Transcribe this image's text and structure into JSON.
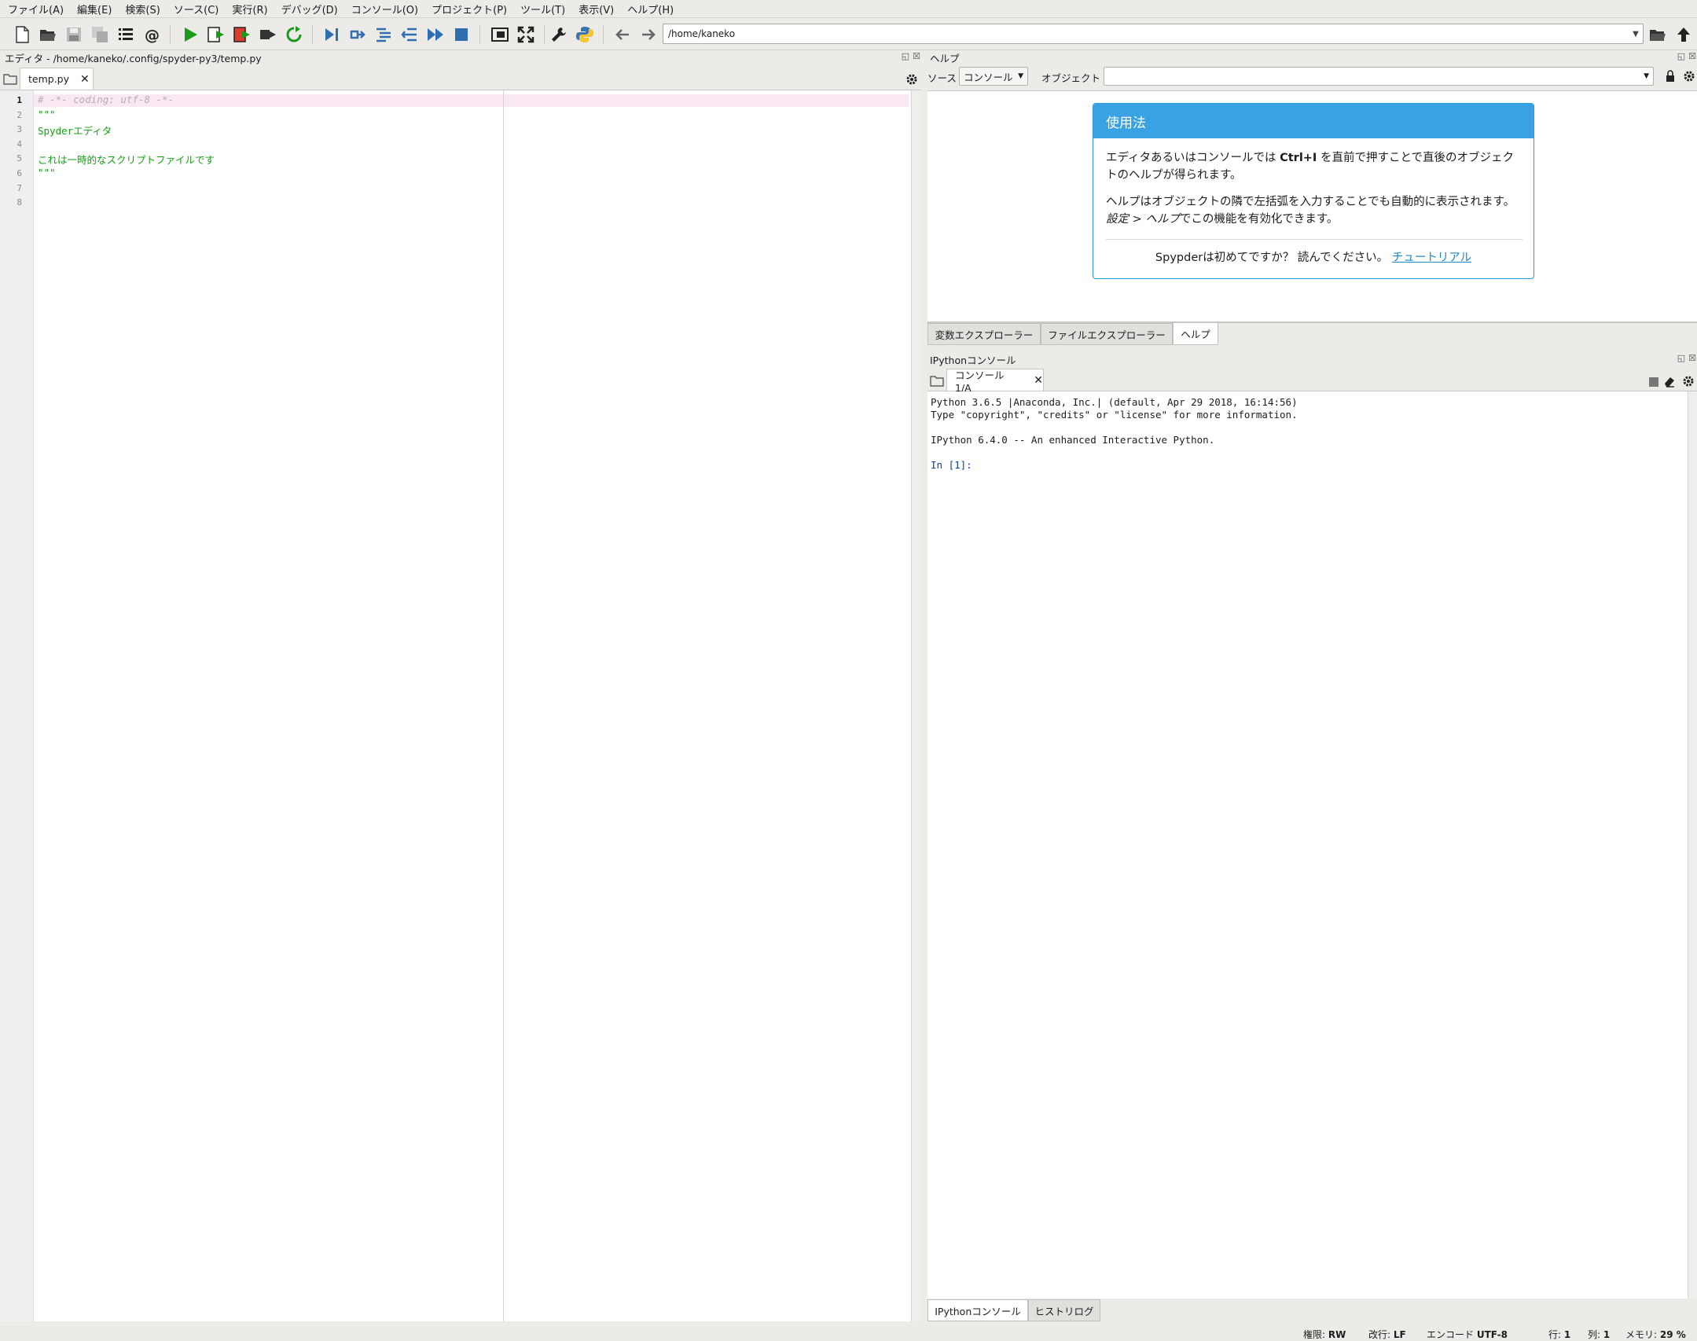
{
  "menubar": {
    "items": [
      "ファイル(A)",
      "編集(E)",
      "検索(S)",
      "ソース(C)",
      "実行(R)",
      "デバッグ(D)",
      "コンソール(O)",
      "プロジェクト(P)",
      "ツール(T)",
      "表示(V)",
      "ヘルプ(H)"
    ]
  },
  "toolbar": {
    "path": "/home/kaneko"
  },
  "editor": {
    "title": "エディタ - /home/kaneko/.config/spyder-py3/temp.py",
    "tab_label": "temp.py",
    "lines": [
      {
        "no": "1",
        "text": "# -*- coding: utf-8 -*-",
        "kind": "comment"
      },
      {
        "no": "2",
        "text": "\"\"\"",
        "kind": "string"
      },
      {
        "no": "3",
        "text": "Spyderエディタ",
        "kind": "string"
      },
      {
        "no": "4",
        "text": "",
        "kind": "string"
      },
      {
        "no": "5",
        "text": "これは一時的なスクリプトファイルです",
        "kind": "string"
      },
      {
        "no": "6",
        "text": "\"\"\"",
        "kind": "string"
      },
      {
        "no": "7",
        "text": "",
        "kind": "plain"
      },
      {
        "no": "8",
        "text": "",
        "kind": "plain"
      }
    ]
  },
  "help": {
    "title": "ヘルプ",
    "source_label": "ソース",
    "source_value": "コンソール",
    "object_label": "オブジェクト",
    "object_value": "",
    "usage_title": "使用法",
    "usage_p1_a": "エディタあるいはコンソールでは ",
    "usage_p1_key": "Ctrl+I",
    "usage_p1_b": " を直前で押すことで直後のオブジェクトのヘルプが得られます。",
    "usage_p2_a": "ヘルプはオブジェクトの隣で左括弧を入力することでも自動的に表示されます。",
    "usage_p2_em": "設定 > ヘルプ",
    "usage_p2_b": "でこの機能を有効化できます。",
    "usage_foot_text": "Spypderは初めてですか？ 読んでください。",
    "usage_foot_link": "チュートリアル",
    "tabs": [
      "変数エクスプローラー",
      "ファイルエクスプローラー",
      "ヘルプ"
    ]
  },
  "console": {
    "title": "IPythonコンソール",
    "tab_label": "コンソール 1/A",
    "lines": [
      "Python 3.6.5 |Anaconda, Inc.| (default, Apr 29 2018, 16:14:56)",
      "Type \"copyright\", \"credits\" or \"license\" for more information.",
      "",
      "IPython 6.4.0 -- An enhanced Interactive Python.",
      "",
      "In [1]:"
    ],
    "bottom_tabs": [
      "IPythonコンソール",
      "ヒストリログ"
    ]
  },
  "status": {
    "perm_label": "権限:",
    "perm_value": "RW",
    "eol_label": "改行:",
    "eol_value": "LF",
    "enc_label": "エンコード",
    "enc_value": "UTF-8",
    "line_label": "行:",
    "line_value": "1",
    "col_label": "列:",
    "col_value": "1",
    "mem_label": "メモリ:",
    "mem_value": "29 %"
  },
  "colors": {
    "comment": "#b2b2b2",
    "string": "#12a312",
    "prompt": "#0a3aa8",
    "accent": "#38a2e2"
  }
}
